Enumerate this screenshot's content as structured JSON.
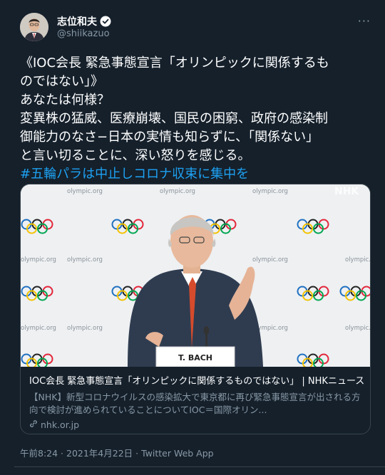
{
  "author": {
    "display_name": "志位和夫",
    "handle": "@shiikazuo",
    "verified": true
  },
  "tweet": {
    "lines": [
      "《IOC会長 緊急事態宣言「オリンピックに関係するも",
      "のではない」》",
      "あなたは何様？",
      "変異株の猛威、医療崩壊、国民の困窮、政府の感染制",
      "御能力のなさ−日本の実情も知らずに、「関係ない」",
      "と言い切ることに、深い怒りを感じる。"
    ],
    "hashtag": "#五輪パラは中止しコロナ収束に集中を"
  },
  "card": {
    "image": {
      "backdrop_text": "olympic.org",
      "watermark": "NHK",
      "nameplate": "T. BACH"
    },
    "title": "IOC会長 緊急事態宣言「オリンピックに関係するものではない」 | NHKニュース",
    "description": "【NHK】新型コロナウイルスの感染拡大で東京都に再び緊急事態宣言が出される方向で検討が進められていることについてIOC＝国際オリン...",
    "domain": "nhk.or.jp"
  },
  "meta": {
    "time_date": "午前8:24 · 2021年4月22日 · ",
    "app": "Twitter Web App"
  },
  "colors": {
    "background": "#15202b",
    "text": "#ffffff",
    "secondary": "#8899a6",
    "link": "#1da1f2",
    "border": "#38444d"
  }
}
